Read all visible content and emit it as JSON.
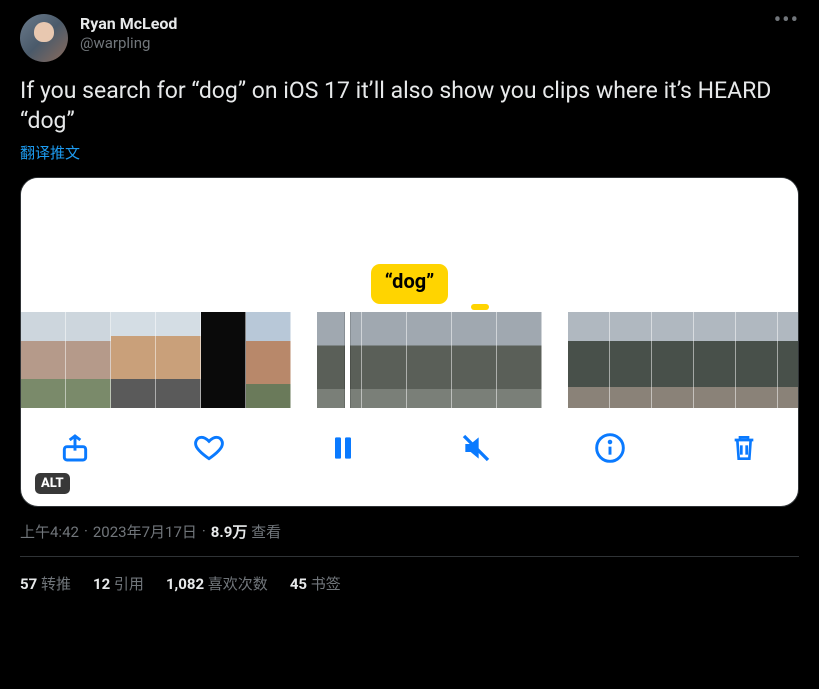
{
  "author": {
    "name": "Ryan McLeod",
    "handle": "@warpling"
  },
  "tweet_text": "If you search for “dog” on iOS 17 it’ll also show you clips where it’s HEARD “dog”",
  "translate_label": "翻译推文",
  "media": {
    "dog_bubble": "“dog”",
    "alt_badge": "ALT"
  },
  "meta": {
    "time": "上午4:42",
    "date": "2023年7月17日",
    "views_count": "8.9万",
    "views_label": "查看"
  },
  "stats": {
    "retweets": {
      "count": "57",
      "label": "转推"
    },
    "quotes": {
      "count": "12",
      "label": "引用"
    },
    "likes": {
      "count": "1,082",
      "label": "喜欢次数"
    },
    "bookmarks": {
      "count": "45",
      "label": "书签"
    }
  }
}
